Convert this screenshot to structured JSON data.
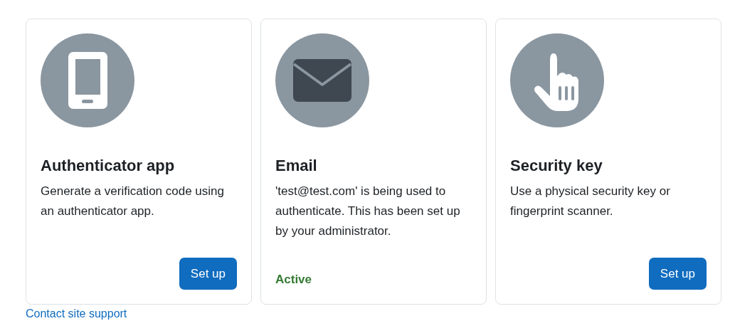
{
  "factors": [
    {
      "kind": "phone",
      "title": "Authenticator app",
      "description": "Generate a verification code using an authenticator app.",
      "footer": {
        "kind": "button",
        "label": "Set up"
      }
    },
    {
      "kind": "envelope",
      "title": "Email",
      "description": "'test@test.com' is being used to authenticate. This has been set up by your administrator.",
      "footer": {
        "kind": "status",
        "label": "Active"
      }
    },
    {
      "kind": "hand",
      "title": "Security key",
      "description": "Use a physical security key or fingerprint scanner.",
      "footer": {
        "kind": "button",
        "label": "Set up"
      }
    }
  ],
  "support_link": "Contact site support"
}
